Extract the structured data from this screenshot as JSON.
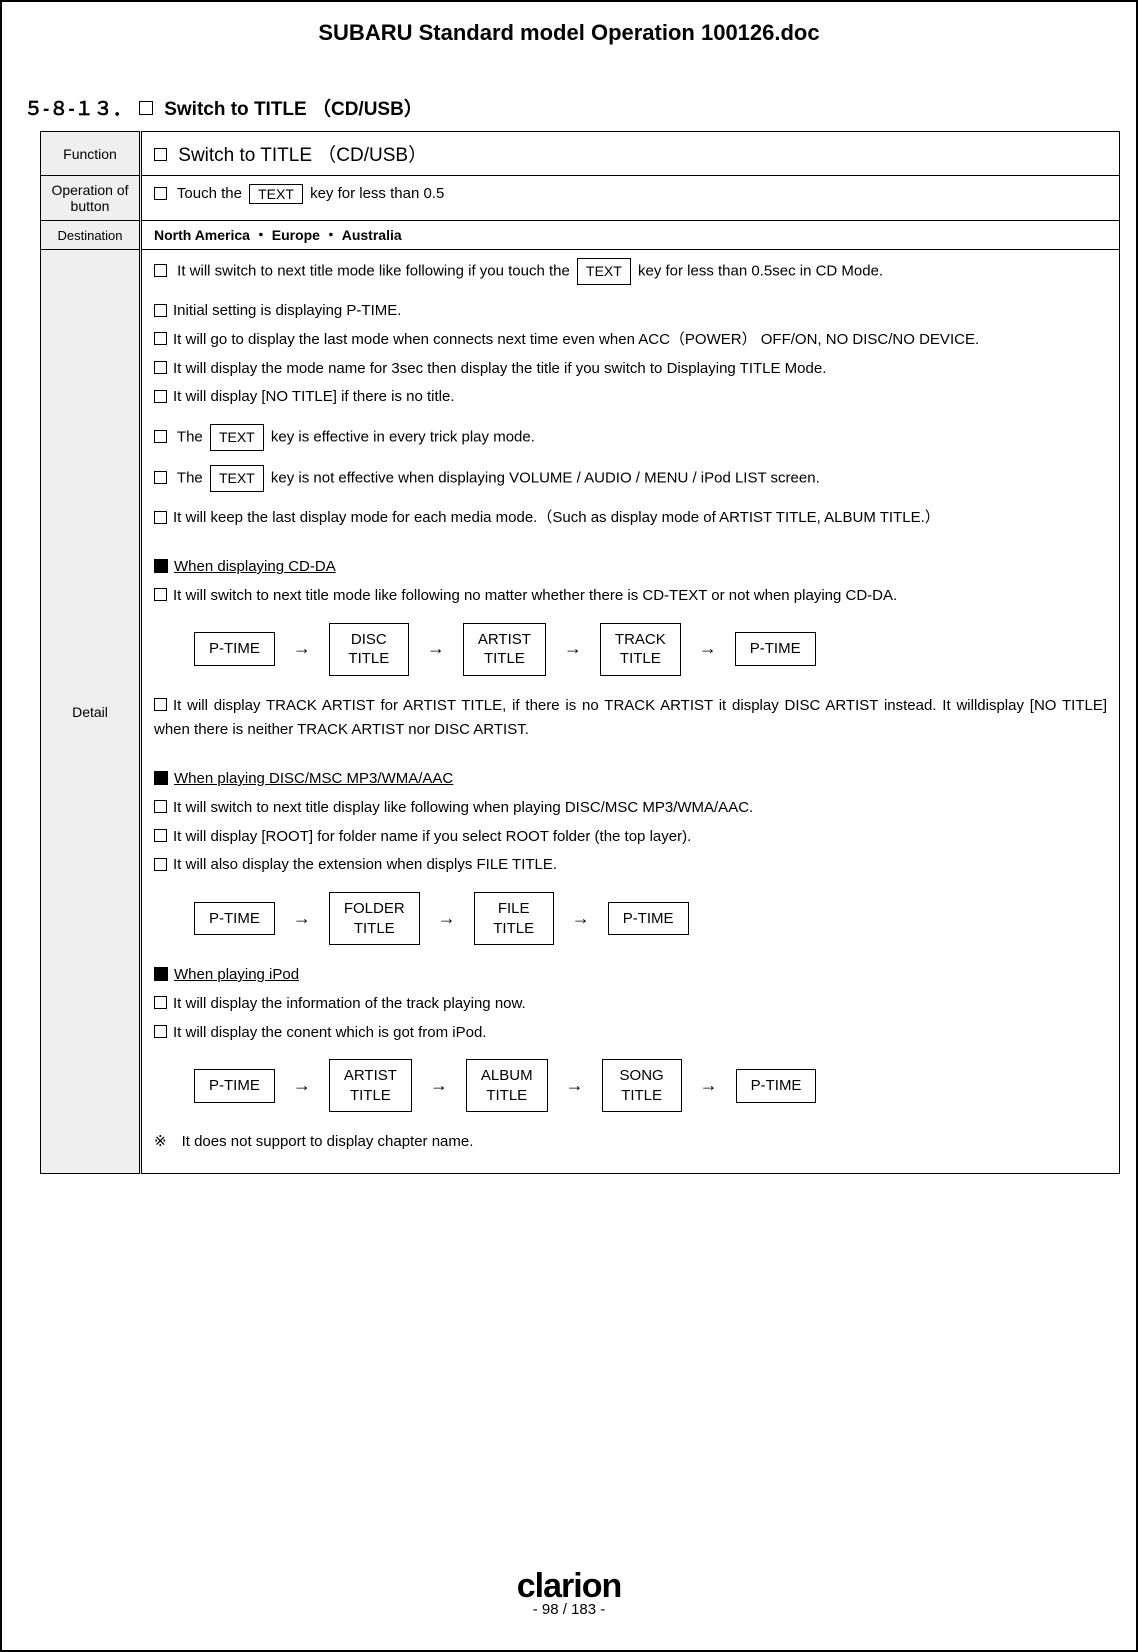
{
  "doc_title": "SUBARU Standard model Operation 100126.doc",
  "section": {
    "number": "５-８-１３．",
    "heading": "Switch to TITLE （CD/USB）"
  },
  "rows": {
    "function": {
      "label": "Function",
      "text": "Switch to TITLE （CD/USB）"
    },
    "operation": {
      "label": "Operation of button",
      "prefix": "Touch the",
      "key": "TEXT",
      "suffix": "key for less than 0.5"
    },
    "destination": {
      "label": "Destination",
      "text": "North America ・ Europe ・ Australia"
    },
    "detail": {
      "label": "Detail"
    }
  },
  "detail": {
    "l1_pre": "It will switch to next title mode like following if you touch the",
    "l1_key": "TEXT",
    "l1_post": "key for less than 0.5sec in CD Mode.",
    "l2": "Initial setting is displaying P-TIME.",
    "l3": "It will go to display the last mode when connects next time even when ACC（POWER） OFF/ON, NO DISC/NO DEVICE.",
    "l4": "It will display the mode name for 3sec then display the title if you switch to Displaying TITLE Mode.",
    "l5": "It will display [NO TITLE] if there is no title.",
    "l6_pre": "The",
    "l6_key": "TEXT",
    "l6_post": "key is effective in every trick play mode.",
    "l7_pre": "The",
    "l7_key": "TEXT",
    "l7_post": "key is not effective when displaying VOLUME / AUDIO / MENU / iPod LIST screen.",
    "l8": "It will keep the last display mode for each media mode.（Such as display mode of ARTIST TITLE, ALBUM TITLE.）",
    "sec1_head": "When displaying CD-DA",
    "sec1_l1": "It will switch to next title mode like following no matter whether there is CD-TEXT or not when playing CD-DA.",
    "sec1_l2": "It will display TRACK ARTIST for ARTIST TITLE, if there is no TRACK ARTIST it display DISC ARTIST instead. It willdisplay [NO TITLE] when there is neither TRACK ARTIST nor DISC ARTIST.",
    "sec2_head": "When playing DISC/MSC MP3/WMA/AAC",
    "sec2_l1": "It will switch to next title display like following when playing DISC/MSC MP3/WMA/AAC.",
    "sec2_l2": "It will display [ROOT] for folder name if you select ROOT folder (the top layer).",
    "sec2_l3": "It will also display the extension when displys FILE TITLE.",
    "sec3_head": "When playing iPod",
    "sec3_l1": "It will display the information of the track playing now.",
    "sec3_l2": "It will display the conent which is got from iPod.",
    "sec3_note": "※　It does not support to display chapter name."
  },
  "flow1": [
    "P-TIME",
    "DISC\nTITLE",
    "ARTIST\nTITLE",
    "TRACK\nTITLE",
    "P-TIME"
  ],
  "flow2": [
    "P-TIME",
    "FOLDER\nTITLE",
    "FILE\nTITLE",
    "P-TIME"
  ],
  "flow3": [
    "P-TIME",
    "ARTIST\nTITLE",
    "ALBUM\nTITLE",
    "SONG\nTITLE",
    "P-TIME"
  ],
  "arrow": "→",
  "footer": {
    "brand": "clarion",
    "page": "- 98 / 183 -"
  }
}
